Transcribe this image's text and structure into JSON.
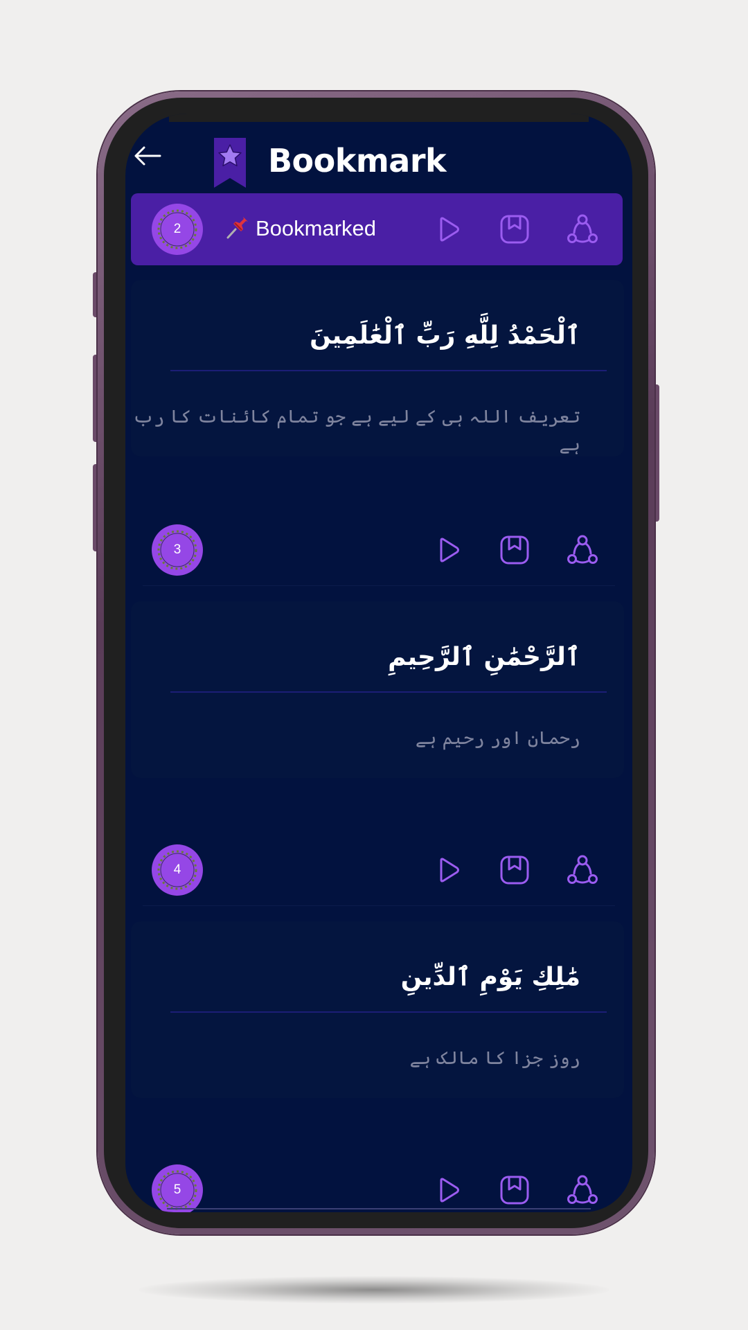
{
  "header": {
    "back_icon": "back-arrow-icon",
    "flag_icon": "star-bookmark-flag-icon",
    "title": "Bookmark"
  },
  "banner": {
    "number": "2",
    "label": "Bookmarked",
    "pin_icon": "pushpin-icon"
  },
  "rows": [
    {
      "number": "3"
    },
    {
      "number": "4"
    },
    {
      "number": "5"
    }
  ],
  "verses": [
    {
      "arabic": "ٱلْحَمْدُ لِلَّهِ رَبِّ ٱلْعَٰلَمِينَ",
      "urdu": "تعریف اللہ ہی کے لیے ہے جو تمام کائنات کا رب ہے"
    },
    {
      "arabic": "ٱلرَّحْمَٰنِ ٱلرَّحِيمِ",
      "urdu": "رحمان اور رحیم ہے"
    },
    {
      "arabic": "مَٰلِكِ يَوْمِ ٱلدِّينِ",
      "urdu": "روز جزا کا مالک ہے"
    }
  ],
  "action_icons": [
    "play-icon",
    "bookmark-icon",
    "share-icon"
  ],
  "colors": {
    "screen_bg": "#02123f",
    "banner_bg": "#4a1fa5",
    "accent": "#9547e6",
    "icon_stroke": "#9b5cf0",
    "urdu_text": "#7f849e"
  }
}
